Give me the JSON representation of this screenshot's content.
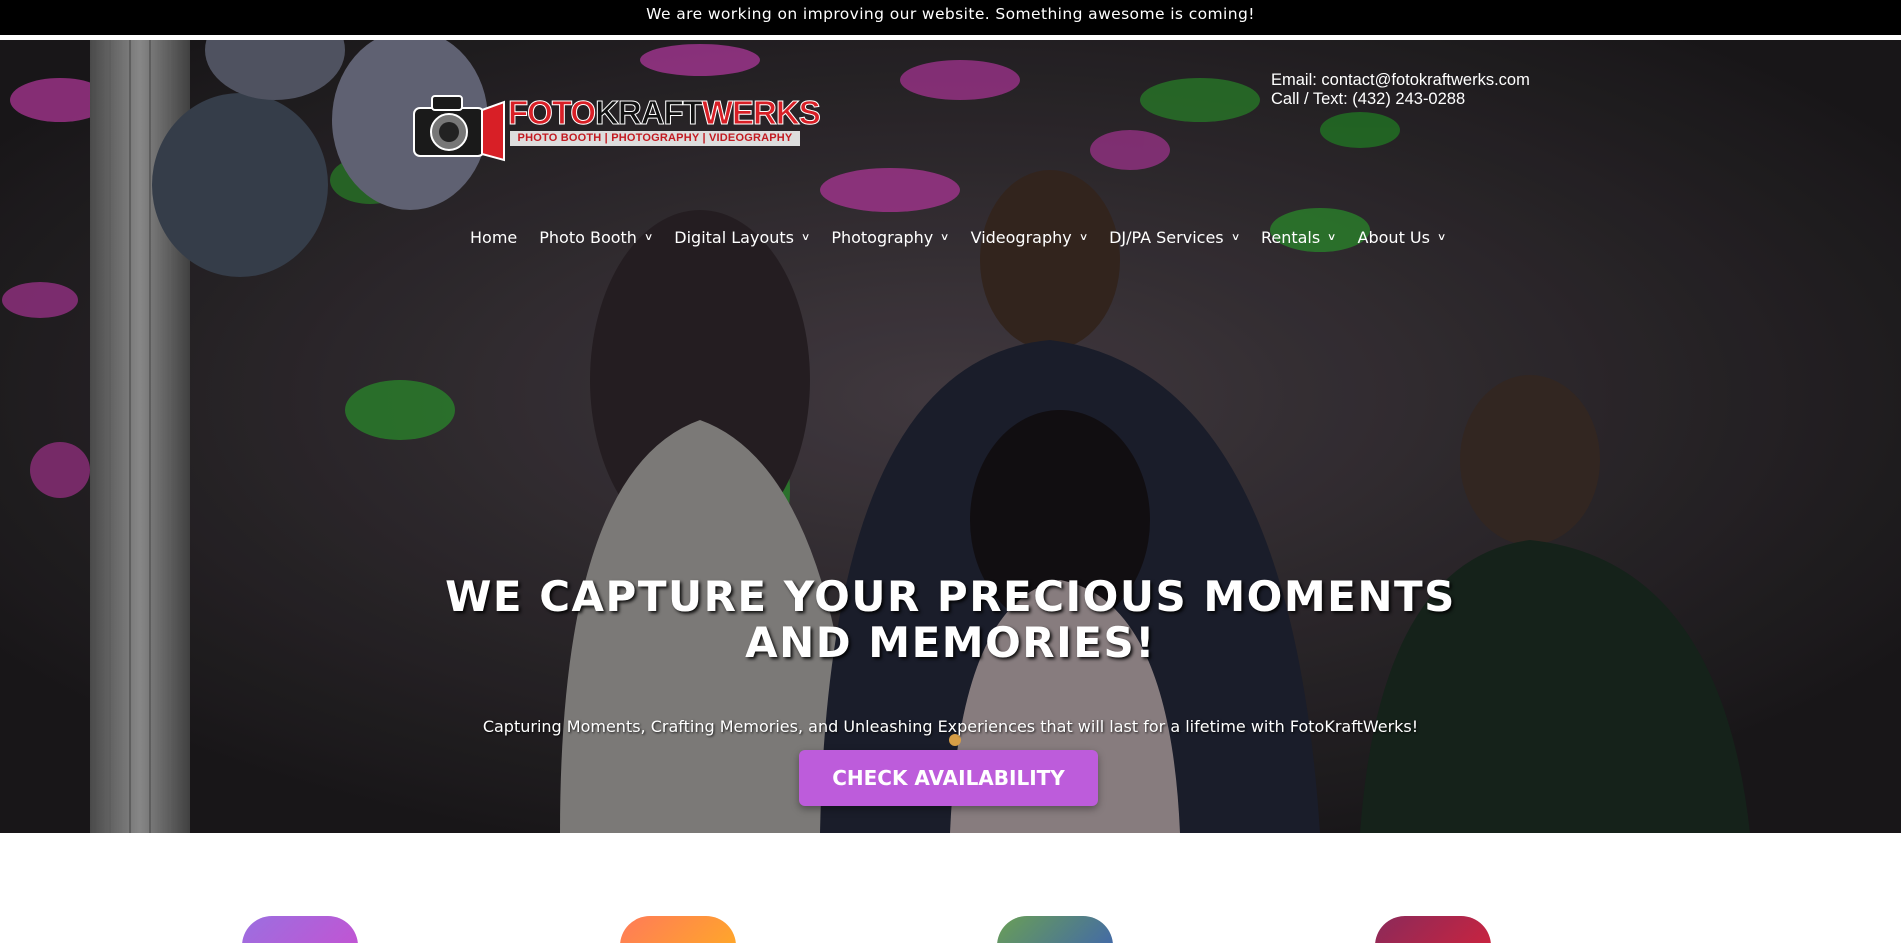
{
  "announcement": {
    "text": "We are working on improving our website. Something awesome is coming!"
  },
  "logo": {
    "word_1": "FOTO",
    "word_2": "KRAFT",
    "word_3": "WERKS",
    "tagline": "PHOTO BOOTH | PHOTOGRAPHY | VIDEOGRAPHY",
    "icon": "camera-icon"
  },
  "contact": {
    "email": "Email: contact@fotokraftwerks.com",
    "phone": "Call / Text: (432) 243-0288"
  },
  "nav": {
    "items": [
      {
        "label": "Home",
        "dropdown": false
      },
      {
        "label": "Photo Booth",
        "dropdown": true
      },
      {
        "label": "Digital Layouts",
        "dropdown": true
      },
      {
        "label": "Photography",
        "dropdown": true
      },
      {
        "label": "Videography",
        "dropdown": true
      },
      {
        "label": "DJ/PA Services",
        "dropdown": true
      },
      {
        "label": "Rentals",
        "dropdown": true
      },
      {
        "label": "About Us",
        "dropdown": true
      }
    ],
    "dropdown_icon": "chevron-down-icon"
  },
  "hero": {
    "headline_line_1": "WE CAPTURE YOUR PRECIOUS MOMENTS",
    "headline_line_2": "AND MEMORIES!",
    "subheadline": "Capturing Moments, Crafting Memories, and Unleashing Experiences that will last for a lifetime with FotoKraftWerks!",
    "cta_label": "CHECK AVAILABILITY"
  },
  "colors": {
    "accent": "#bd5cdb",
    "announcement_bg": "#000000",
    "logo_red": "#d81f26"
  },
  "features": [
    {
      "name": "feature-icon-purple",
      "gradient": [
        "#9b6fe0",
        "#c94fd0"
      ]
    },
    {
      "name": "feature-icon-orange",
      "gradient": [
        "#ff7a59",
        "#ffb020"
      ]
    },
    {
      "name": "feature-icon-green",
      "gradient": [
        "#6a9f55",
        "#3b5fb8"
      ]
    },
    {
      "name": "feature-icon-red",
      "gradient": [
        "#8a2a5a",
        "#d6223a"
      ]
    }
  ]
}
